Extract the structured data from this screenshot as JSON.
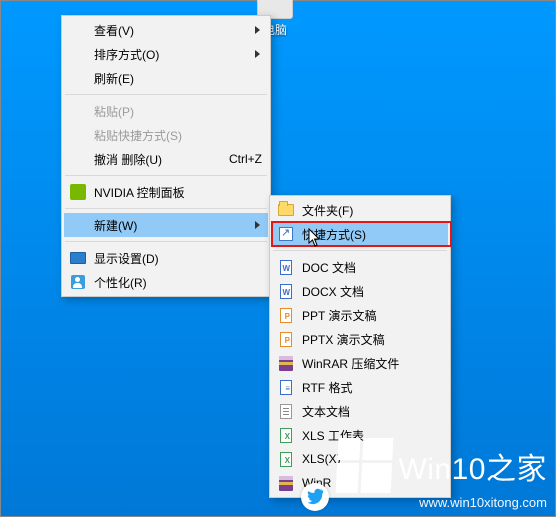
{
  "desktop": {
    "icon_label": "电脑"
  },
  "menu1": {
    "view": "查看(V)",
    "sort": "排序方式(O)",
    "refresh": "刷新(E)",
    "paste": "粘贴(P)",
    "paste_shortcut": "粘贴快捷方式(S)",
    "undo_delete": "撤消 删除(U)",
    "undo_shortcut": "Ctrl+Z",
    "nvidia": "NVIDIA 控制面板",
    "new": "新建(W)",
    "display": "显示设置(D)",
    "personalize": "个性化(R)"
  },
  "menu2": {
    "folder": "文件夹(F)",
    "shortcut": "快捷方式(S)",
    "doc": "DOC 文档",
    "docx": "DOCX 文档",
    "ppt": "PPT 演示文稿",
    "pptx": "PPTX 演示文稿",
    "winrar": "WinRAR 压缩文件",
    "rtf": "RTF 格式",
    "txt": "文本文档",
    "xls": "XLS 工作表",
    "xlsx": "XLS(X)",
    "winrar_zip": "WinR"
  },
  "watermark": {
    "brand_a": "Win",
    "brand_b": "10",
    "brand_c": "之家",
    "url": "www.win10xitong.com"
  }
}
